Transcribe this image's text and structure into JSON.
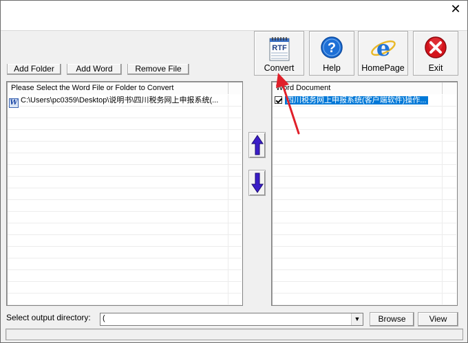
{
  "window": {
    "close_glyph": "✕"
  },
  "toolbar": {
    "add_folder": "Add Folder",
    "add_word": "Add Word",
    "remove_file": "Remove File",
    "convert": {
      "label": "Convert",
      "icon": "rtf-notepad-icon",
      "icon_text": "RTF"
    },
    "help": {
      "label": "Help",
      "icon": "help-icon",
      "icon_text": "?"
    },
    "homepage": {
      "label": "HomePage",
      "icon": "ie-icon",
      "icon_text": "e"
    },
    "exit": {
      "label": "Exit",
      "icon": "exit-icon",
      "icon_text": "✕"
    }
  },
  "left_panel": {
    "header": "Please Select the Word File or Folder to Convert",
    "rows": [
      {
        "icon": "word-doc-icon",
        "icon_text": "W",
        "path": "C:\\Users\\pc0359\\Desktop\\说明书\\四川税务网上申报系统(..."
      }
    ]
  },
  "right_panel": {
    "header": "Word Document",
    "rows": [
      {
        "checked": true,
        "name": "四川税务网上申报系统(客户端软件)操作..."
      }
    ]
  },
  "move_buttons": {
    "up_icon": "arrow-up-icon",
    "down_icon": "arrow-down-icon"
  },
  "output": {
    "label": "Select  output directory:",
    "value": "(",
    "dropdown_glyph": "▼",
    "browse": "Browse",
    "view": "View"
  },
  "colors": {
    "selection": "#0078d7",
    "arrow_purple": "#3b1ec8",
    "annotation_red": "#e0202a",
    "exit_red": "#d4141c",
    "help_blue": "#1d6fd6"
  }
}
